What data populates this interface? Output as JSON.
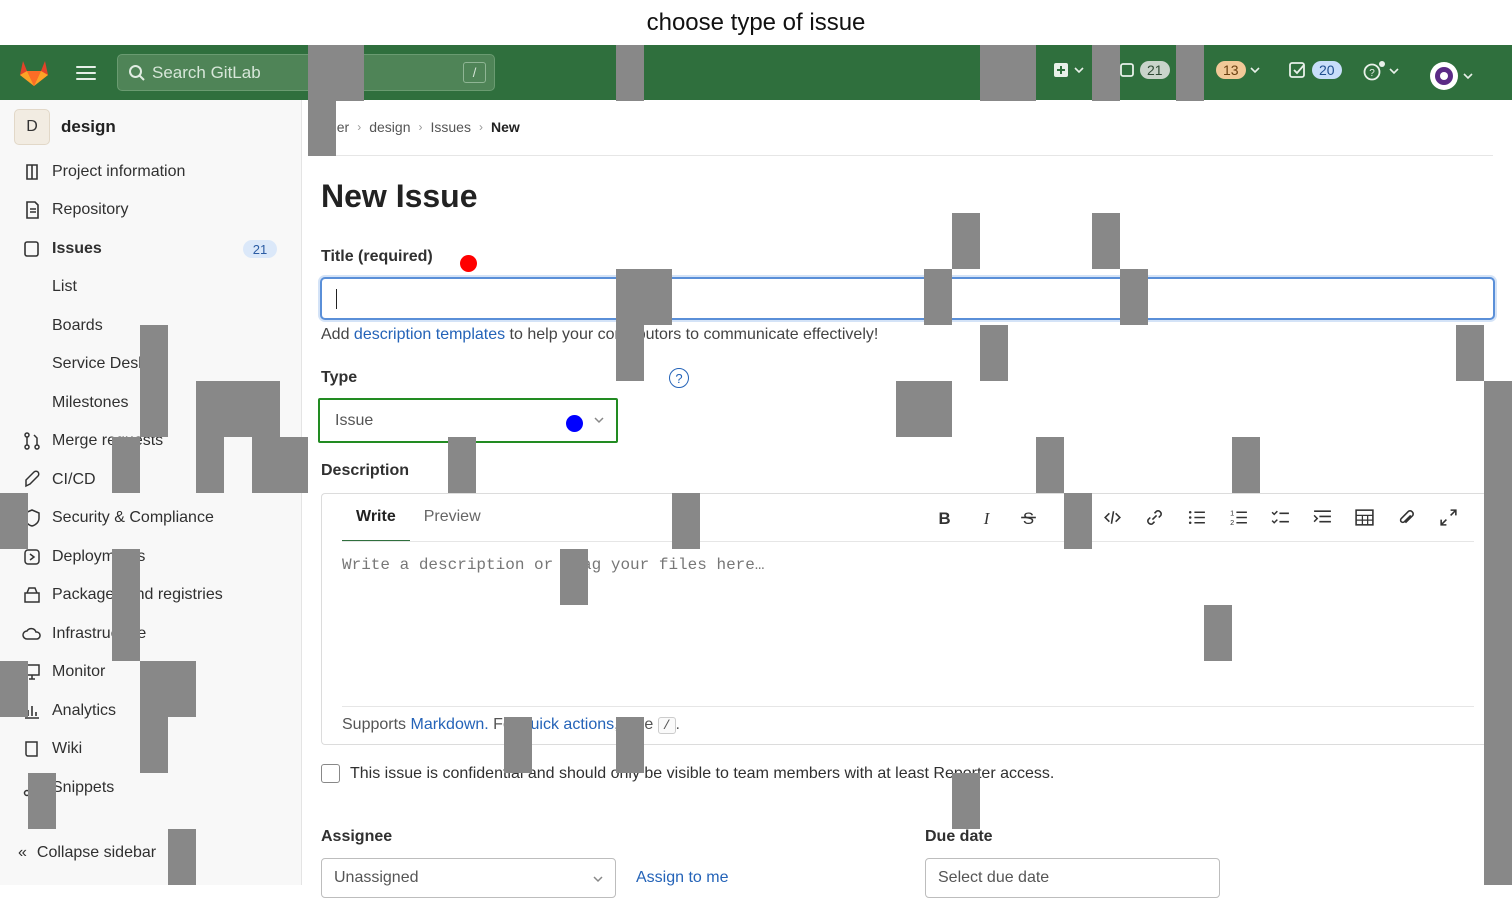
{
  "caption": "choose type of issue",
  "search": {
    "placeholder": "Search GitLab",
    "shortcut": "/"
  },
  "topnav": {
    "mr_count": "21",
    "review_count": "13",
    "todo_count": "20"
  },
  "sidebar": {
    "project_initial": "D",
    "project_name": "design",
    "items": [
      {
        "label": "Project information"
      },
      {
        "label": "Repository"
      },
      {
        "label": "Issues",
        "count": "21"
      },
      {
        "label": "List"
      },
      {
        "label": "Boards"
      },
      {
        "label": "Service Desk"
      },
      {
        "label": "Milestones"
      },
      {
        "label": "Merge requests"
      },
      {
        "label": "CI/CD"
      },
      {
        "label": "Security & Compliance"
      },
      {
        "label": "Deployments"
      },
      {
        "label": "Packages and registries"
      },
      {
        "label": "Infrastructure"
      },
      {
        "label": "Monitor"
      },
      {
        "label": "Analytics"
      },
      {
        "label": "Wiki"
      },
      {
        "label": "Snippets"
      }
    ],
    "collapse_label": "Collapse sidebar"
  },
  "breadcrumb": {
    "items": [
      "imer",
      "design",
      "Issues",
      "New"
    ]
  },
  "page_title": "New Issue",
  "form": {
    "title_label": "Title (required)",
    "hint_prefix": "Add ",
    "hint_link": "description templates",
    "hint_suffix": " to help your contributors to communicate effectively!",
    "type_label": "Type",
    "type_value": "Issue",
    "description_label": "Description",
    "tab_write": "Write",
    "tab_preview": "Preview",
    "textarea_placeholder": "Write a description or drag your files here…",
    "footer_prefix": "Supports ",
    "footer_markdown": "Markdown.",
    "footer_mid": " For ",
    "footer_quick": "quick actions",
    "footer_type": ", type ",
    "footer_kbd": "/",
    "footer_end": ".",
    "confidential": "This issue is confidential and should only be visible to team members with at least Reporter access.",
    "assignee_label": "Assignee",
    "assignee_value": "Unassigned",
    "assign_me": "Assign to me",
    "due_label": "Due date",
    "due_placeholder": "Select due date"
  },
  "colors": {
    "nav": "#2f6f3d",
    "link": "#2463b8",
    "focus": "#228b22",
    "marker_red": "#ff0000",
    "marker_blue": "#0000ff"
  }
}
